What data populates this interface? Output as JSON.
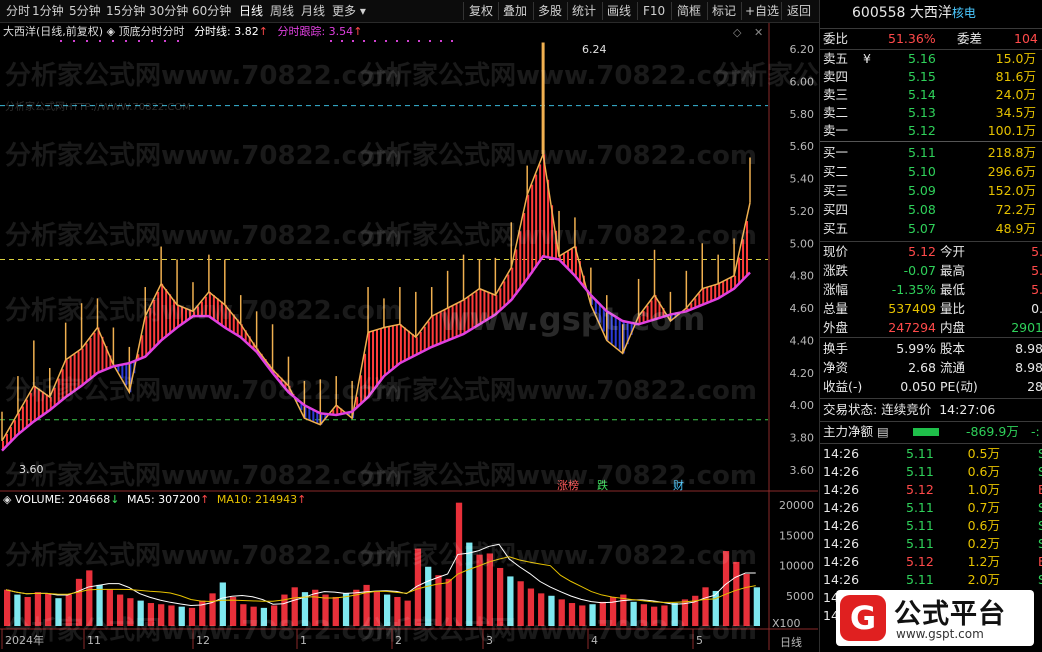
{
  "toolbar": {
    "left_items": [
      "分时",
      "1分钟",
      "5分钟",
      "15分钟",
      "30分钟",
      "60分钟",
      "日线",
      "周线",
      "月线",
      "更多"
    ],
    "more_arrow": "▾",
    "right_items": [
      "复权",
      "叠加",
      "多股",
      "统计",
      "画线",
      "F10",
      "简框",
      "标记",
      "+自选",
      "返回"
    ]
  },
  "header": {
    "stock_name": "大西洋(日线,前复权)",
    "indicator_name": "顶底分时分时",
    "fenshi_line": "分时线: 3.82",
    "fenshi_follow": "分时跟踪: 3.54",
    "up_arrow": "↑"
  },
  "volume_header": {
    "volume": "VOLUME: 204668",
    "volume_arrow": "↓",
    "ma5": "MA5: 307200",
    "ma5_arrow": "↑",
    "ma10": "MA10: 214943",
    "ma10_arrow": "↑"
  },
  "annotations": {
    "high": "6.24",
    "low": "3.60",
    "tags": [
      "涨榜",
      "跌",
      "财"
    ]
  },
  "xaxis": {
    "labels": [
      "2024年",
      "11",
      "12",
      "1",
      "2",
      "3",
      "4",
      "5"
    ],
    "x100": "X100",
    "period": "日线"
  },
  "watermarks": {
    "site": "分析家公式网www.70822.com",
    "gspt": "www.gspt.com",
    "small": "分析家公式网HTTP://WWW.70822.COM"
  },
  "colors": {
    "up": "#ff3b3b",
    "down": "#2f9a4a",
    "gold": "#f0b050",
    "ma": "#e040e0",
    "dash_yellow": "#d8d040",
    "dash_green": "#3cc84a",
    "dash_cyan": "#3ab8d8",
    "vol_up": "#e8303a",
    "vol_down": "#7ee8f0"
  },
  "chart_data": {
    "type": "line",
    "title": "大西洋(日线,前复权)",
    "ylim": [
      3.5,
      6.3
    ],
    "yticks": [
      "6.20",
      "6.00",
      "5.80",
      "5.60",
      "5.40",
      "5.20",
      "5.00",
      "4.80",
      "4.60",
      "4.40",
      "4.20",
      "4.00",
      "3.80",
      "3.60"
    ],
    "guide_lines": [
      5.85,
      4.9,
      3.91
    ],
    "series": [
      {
        "name": "分时线",
        "values": [
          3.78,
          3.95,
          4.12,
          4.05,
          4.28,
          4.35,
          4.48,
          4.25,
          4.08,
          4.55,
          4.75,
          4.62,
          4.58,
          4.7,
          4.62,
          4.5,
          4.35,
          4.22,
          4.12,
          3.92,
          3.88,
          4.0,
          3.92,
          4.45,
          4.48,
          4.5,
          4.42,
          4.55,
          4.6,
          4.65,
          4.72,
          4.68,
          4.85,
          5.3,
          5.55,
          4.92,
          4.98,
          4.62,
          4.4,
          4.32,
          4.55,
          4.68,
          4.52,
          4.6,
          4.72,
          4.75,
          4.8,
          5.25
        ]
      },
      {
        "name": "分时跟踪",
        "values": [
          3.72,
          3.82,
          3.9,
          3.97,
          4.05,
          4.12,
          4.2,
          4.24,
          4.26,
          4.3,
          4.4,
          4.48,
          4.55,
          4.55,
          4.48,
          4.42,
          4.33,
          4.2,
          4.08,
          4.0,
          3.95,
          3.94,
          3.96,
          4.05,
          4.18,
          4.26,
          4.31,
          4.36,
          4.4,
          4.44,
          4.5,
          4.56,
          4.65,
          4.78,
          4.92,
          4.9,
          4.8,
          4.68,
          4.58,
          4.52,
          4.5,
          4.53,
          4.56,
          4.58,
          4.62,
          4.66,
          4.72,
          4.82
        ]
      }
    ],
    "volume": {
      "yticks": [
        "20000",
        "15000",
        "10000",
        "5000"
      ],
      "ylim": [
        0,
        22000
      ],
      "values": [
        6000,
        5200,
        4800,
        5600,
        5400,
        4600,
        5200,
        7800,
        9200,
        6800,
        6000,
        5200,
        4600,
        4200,
        3800,
        3600,
        3400,
        3200,
        3000,
        4200,
        5400,
        7200,
        4800,
        3600,
        3200,
        3000,
        3400,
        5200,
        6400,
        5600,
        6000,
        5200,
        4800,
        5400,
        6000,
        6800,
        5800,
        5200,
        4800,
        4200,
        12800,
        9800,
        8400,
        7800,
        20400,
        13800,
        11800,
        12000,
        9600,
        8200,
        7400,
        6200,
        5400,
        5000,
        4400,
        3800,
        3400,
        3600,
        4000,
        4800,
        5200,
        4000,
        3600,
        3200,
        3400,
        3800,
        4400,
        5000,
        6400,
        5800,
        12400,
        10600,
        8600,
        6400
      ]
    }
  },
  "quote": {
    "code": "600558",
    "name": "大西洋",
    "tag": "核电",
    "weibi_label": "委比",
    "weibi_value": "51.36%",
    "weicha_label": "委差",
    "weicha_value": "104",
    "sells": [
      {
        "label": "卖五",
        "mark": "¥",
        "price": "5.16",
        "vol": "15.0万"
      },
      {
        "label": "卖四",
        "mark": "",
        "price": "5.15",
        "vol": "81.6万"
      },
      {
        "label": "卖三",
        "mark": "",
        "price": "5.14",
        "vol": "24.0万"
      },
      {
        "label": "卖二",
        "mark": "",
        "price": "5.13",
        "vol": "34.5万"
      },
      {
        "label": "卖一",
        "mark": "",
        "price": "5.12",
        "vol": "100.1万"
      }
    ],
    "buys": [
      {
        "label": "买一",
        "price": "5.11",
        "vol": "218.8万"
      },
      {
        "label": "买二",
        "price": "5.10",
        "vol": "296.6万"
      },
      {
        "label": "买三",
        "price": "5.09",
        "vol": "152.0万"
      },
      {
        "label": "买四",
        "price": "5.08",
        "vol": "72.2万"
      },
      {
        "label": "买五",
        "price": "5.07",
        "vol": "48.9万"
      }
    ],
    "stats": [
      {
        "l1": "现价",
        "v1": "5.12",
        "c1": "red",
        "l2": "今开",
        "v2": "5.",
        "c2": "red"
      },
      {
        "l1": "涨跌",
        "v1": "-0.07",
        "c1": "green",
        "l2": "最高",
        "v2": "5.",
        "c2": "red"
      },
      {
        "l1": "涨幅",
        "v1": "-1.35%",
        "c1": "green",
        "l2": "最低",
        "v2": "5.",
        "c2": "red"
      },
      {
        "l1": "总量",
        "v1": "537409",
        "c1": "yel",
        "l2": "量比",
        "v2": "0.",
        "c2": "white"
      },
      {
        "l1": "外盘",
        "v1": "247294",
        "c1": "red",
        "l2": "内盘",
        "v2": "2901",
        "c2": "green"
      }
    ],
    "stats2": [
      {
        "l1": "换手",
        "v1": "5.99%",
        "l2": "股本",
        "v2": "8.98"
      },
      {
        "l1": "净资",
        "v1": "2.68",
        "l2": "流通",
        "v2": "8.98"
      },
      {
        "l1": "收益(-)",
        "v1": "0.050",
        "l2": "PE(动)",
        "v2": "28"
      }
    ],
    "trade_status_label": "交易状态:",
    "trade_status": "连续竞价",
    "trade_time": "14:27:06",
    "main_net_label": "主力净额",
    "main_net_icon": "▤",
    "main_net_value": "-869.9万",
    "main_net_extra": "-:",
    "ticks": [
      {
        "t": "14:26",
        "p": "5.11",
        "v": "0.5万",
        "s": "S"
      },
      {
        "t": "14:26",
        "p": "5.11",
        "v": "0.6万",
        "s": "S"
      },
      {
        "t": "14:26",
        "p": "5.12",
        "v": "1.0万",
        "s": "B"
      },
      {
        "t": "14:26",
        "p": "5.11",
        "v": "0.7万",
        "s": "S"
      },
      {
        "t": "14:26",
        "p": "5.11",
        "v": "0.6万",
        "s": "S"
      },
      {
        "t": "14:26",
        "p": "5.11",
        "v": "0.2万",
        "s": "S"
      },
      {
        "t": "14:26",
        "p": "5.12",
        "v": "1.2万",
        "s": "B"
      },
      {
        "t": "14:26",
        "p": "5.11",
        "v": "2.0万",
        "s": "S"
      },
      {
        "t": "14:",
        "p": "",
        "v": "",
        "s": ""
      },
      {
        "t": "14:",
        "p": "",
        "v": "",
        "s": ""
      }
    ]
  },
  "logo": {
    "text": "公式平台",
    "url": "www.gspt.com",
    "mark": "G"
  }
}
